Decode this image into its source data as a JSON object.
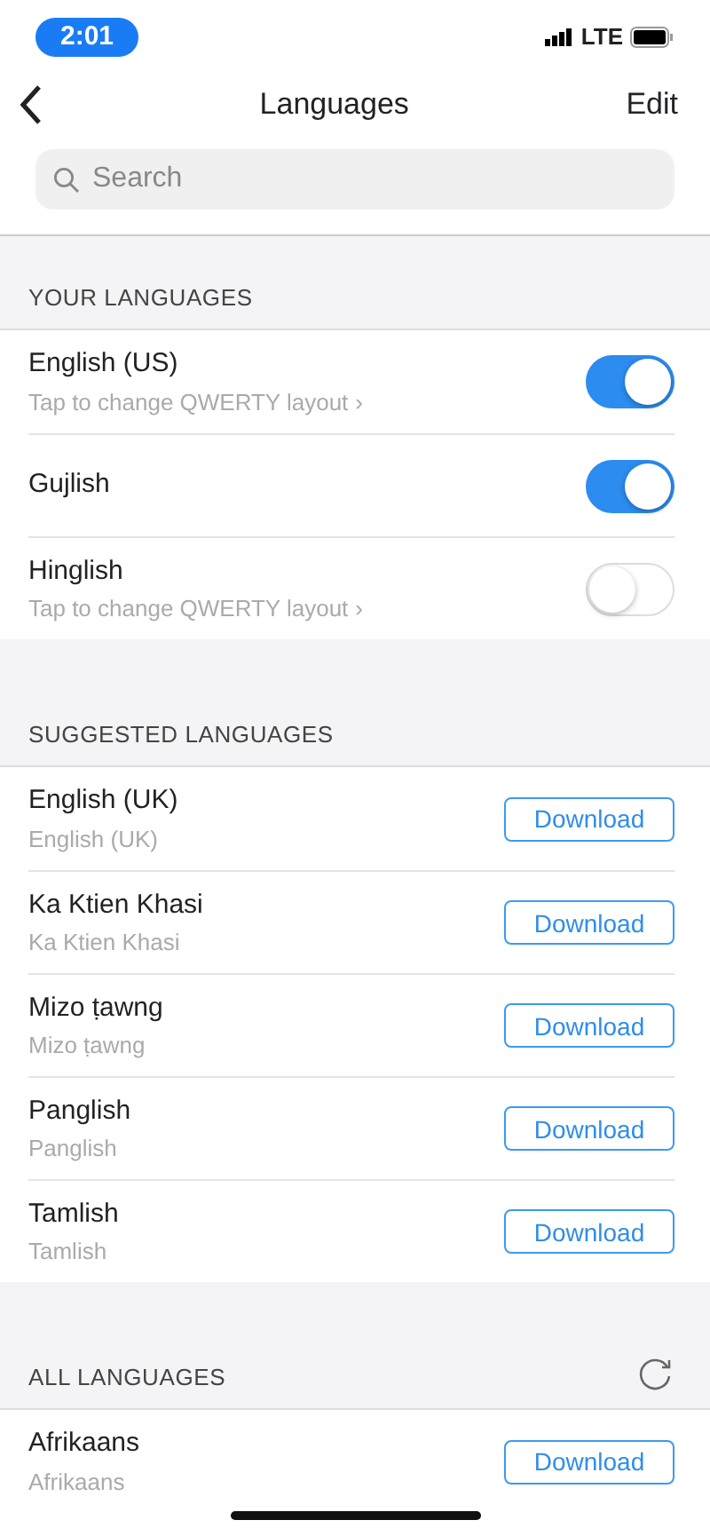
{
  "status_bar": {
    "time": "2:01",
    "network": "LTE"
  },
  "nav": {
    "title": "Languages",
    "action": "Edit"
  },
  "search": {
    "placeholder": "Search"
  },
  "sections": [
    {
      "title": "YOUR LANGUAGES",
      "items": [
        {
          "kind": "toggle",
          "name": "English (US)",
          "subtitle": "Tap to change QWERTY layout",
          "chevron": "›",
          "on": true
        },
        {
          "kind": "toggle",
          "name": "Gujlish",
          "on": true
        },
        {
          "kind": "toggle",
          "name": "Hinglish",
          "subtitle": "Tap to change QWERTY layout",
          "chevron": "›",
          "on": false
        }
      ]
    },
    {
      "title": "SUGGESTED LANGUAGES",
      "items": [
        {
          "kind": "download",
          "name": "English (UK)",
          "subtitle": "English (UK)",
          "button": "Download"
        },
        {
          "kind": "download",
          "name": "Ka Ktien Khasi",
          "subtitle": "Ka Ktien Khasi",
          "button": "Download"
        },
        {
          "kind": "download",
          "name": "Mizo ṭawng",
          "subtitle": "Mizo ṭawng",
          "button": "Download"
        },
        {
          "kind": "download",
          "name": "Panglish",
          "subtitle": "Panglish",
          "button": "Download"
        },
        {
          "kind": "download",
          "name": "Tamlish",
          "subtitle": "Tamlish",
          "button": "Download"
        }
      ]
    },
    {
      "title": "ALL LANGUAGES",
      "refresh": true,
      "items": [
        {
          "kind": "download",
          "name": "Afrikaans",
          "subtitle": "Afrikaans",
          "button": "Download"
        }
      ]
    }
  ]
}
